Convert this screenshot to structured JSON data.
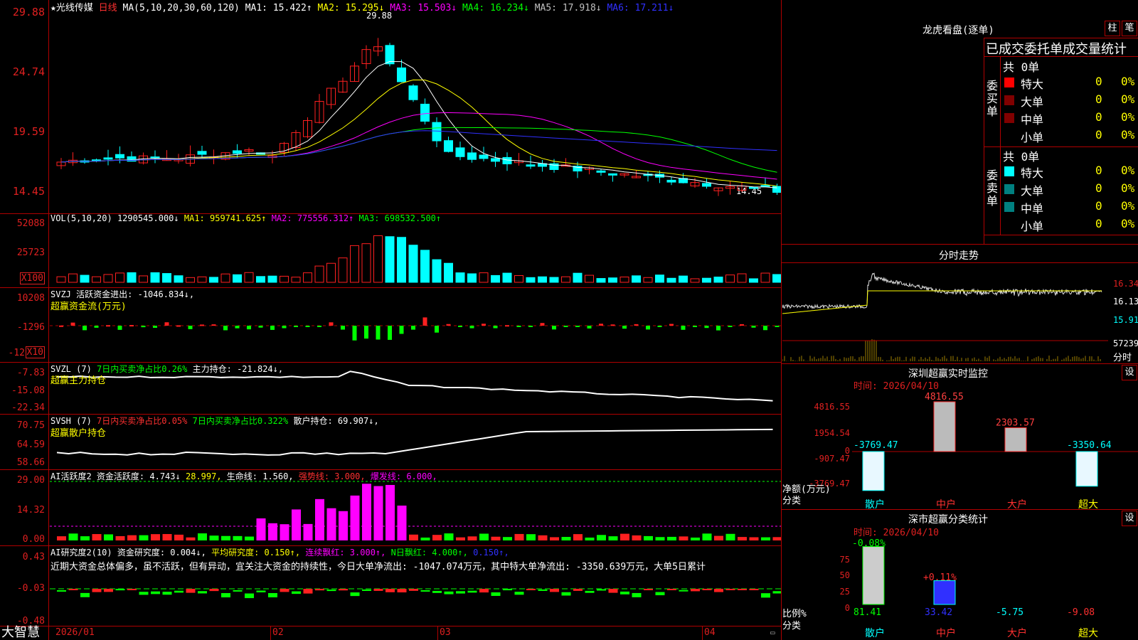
{
  "stock": {
    "name": "★光线传媒",
    "period": "日线",
    "ma_label": "MA(5,10,20,30,60,120)",
    "ma1": "MA1: 15.422↑",
    "ma2": "MA2: 15.295↓",
    "ma3": "MA3: 15.503↓",
    "ma4": "MA4: 16.234↓",
    "ma5": "MA5: 17.918↓",
    "ma6": "MA6: 17.211↓",
    "high_mark": "29.88",
    "low_mark": "14.45"
  },
  "price_axis": [
    "29.88",
    "24.74",
    "19.59",
    "14.45"
  ],
  "vol": {
    "label": "VOL(5,10,20)",
    "value": "1290545.000↓",
    "ma1": "MA1: 959741.625↑",
    "ma2": "MA2: 775556.312↑",
    "ma3": "MA3: 698532.500↑",
    "axis": [
      "52088",
      "25723"
    ],
    "unit": "X100"
  },
  "svzj": {
    "label": "SVZJ",
    "text": "活跃资金进出: -1046.834↓,",
    "subtitle": "超赢资金流(万元)",
    "axis": [
      "10208",
      "-1296",
      "-12"
    ],
    "unit": "X10"
  },
  "svzl": {
    "label": "SVZL (7)",
    "t1": "7日内买卖净占比0.26%",
    "t2": "主力持仓: -21.824↓,",
    "subtitle": "超赢主力持仓",
    "axis": [
      "-7.83",
      "-15.08",
      "-22.34"
    ]
  },
  "svsh": {
    "label": "SVSH (7)",
    "t1": "7日内买卖净占比0.05%",
    "t2": "7日内买卖净占比0.322%",
    "t3": "散户持仓: 69.907↓,",
    "subtitle": "超赢散户持仓",
    "axis": [
      "70.75",
      "64.59",
      "58.66"
    ]
  },
  "ai2": {
    "label": "AI活跃度2",
    "t1": "资金活跃度: 4.743↓",
    "t2": "28.997,",
    "t3": "生命线: 1.560,",
    "t4": "强势线: 3.000,",
    "t5": "爆发线: 6.000,",
    "axis": [
      "29.00",
      "14.32",
      "0.00"
    ]
  },
  "ai_res": {
    "label": "AI研究度2(10)",
    "t1": "资金研究度: 0.004↓,",
    "t2": "平均研究度: 0.150↑,",
    "t3": "连续飘红: 3.000↑,",
    "t4": "N日飘红: 4.000↑,",
    "t5": "0.150↑,",
    "desc": "近期大资金总体偏多，虽不活跃，但有异动，宜关注大资金的持续性，今日大单净流出: -1047.074万元，其中特大单净流出: -3350.639万元，大单5日累计",
    "axis": [
      "0.43",
      "-0.03",
      "-0.48"
    ]
  },
  "x_axis": [
    "2026/01",
    "02",
    "03",
    "04"
  ],
  "brand": "大智慧",
  "right": {
    "longhu_title": "龙虎看盘(逐单)",
    "btn1": "柱",
    "btn2": "笔",
    "stat_title": "已成交委托单成交量统计",
    "buy_label": "委买单",
    "sell_label": "委卖单",
    "total": "共 0单",
    "rows": [
      "特大",
      "大单",
      "中单",
      "小单"
    ],
    "zero": "0",
    "pct": "0%",
    "buy_colors": [
      "#ff0000",
      "#800000",
      "#800000",
      "#000000"
    ],
    "sell_colors": [
      "#00ffff",
      "#008080",
      "#008080",
      "#000000"
    ],
    "fs_title": "分时走势",
    "fs_axis": [
      "16.34",
      "16.13",
      "15.91"
    ],
    "fs_vol": "57239",
    "fs_label": "分时",
    "sz_title": "深圳超赢实时监控",
    "sz_btn": "设",
    "sz_time": "时间: 2026/04/10",
    "sz_axis": [
      "4816.55",
      "1954.54",
      "0",
      "-907.47",
      "-3769.47"
    ],
    "sz_vals": [
      "-3769.47",
      "4816.55",
      "2303.57",
      "-3350.64"
    ],
    "sz_ylabel": "净额(万元)",
    "sz_xlabel": "分类",
    "cats": [
      "散户",
      "中户",
      "大户",
      "超大"
    ],
    "fl_title": "深市超赢分类统计",
    "fl_btn": "设",
    "fl_time": "时间: 2026/04/10",
    "fl_axis": [
      "75",
      "50",
      "25",
      "0"
    ],
    "fl_top": [
      "-0.08%",
      "+0.11%"
    ],
    "fl_vals": [
      "81.41",
      "33.42",
      "-5.75",
      "-9.08"
    ],
    "fl_ylabel": "比例%",
    "fl_xlabel": "分类"
  },
  "colors": {
    "up": "#ff2020",
    "down": "#00ffff",
    "grid": "#b00000",
    "ma1": "#ffffff",
    "ma2": "#ffff00",
    "ma3": "#ff00ff",
    "ma4": "#00ff00",
    "ma5": "#a0a0a0",
    "ma6": "#3030ff"
  }
}
